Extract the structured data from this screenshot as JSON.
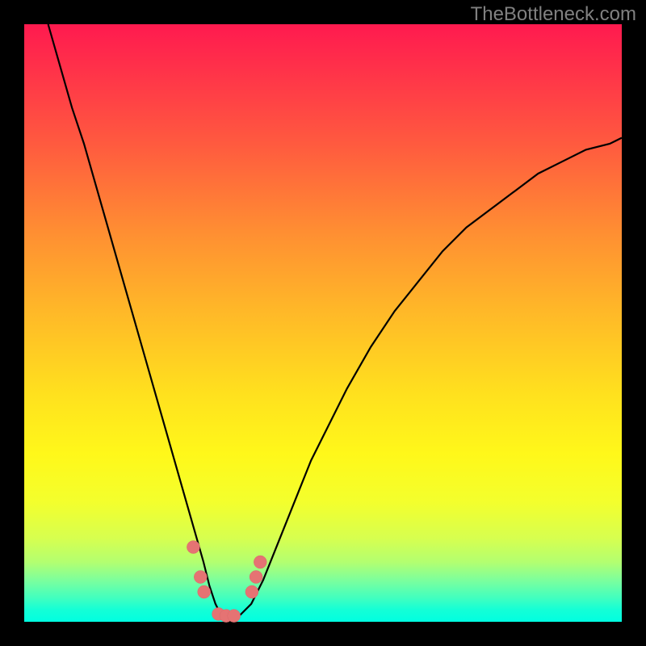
{
  "watermark": "TheBottleneck.com",
  "chart_data": {
    "type": "line",
    "title": "",
    "xlabel": "",
    "ylabel": "",
    "xlim": [
      0,
      100
    ],
    "ylim": [
      0,
      100
    ],
    "grid": false,
    "legend": false,
    "background_gradient": {
      "top": "#ff1a4f",
      "bottom": "#00ffe1"
    },
    "series": [
      {
        "name": "curve",
        "color": "#000000",
        "x": [
          4,
          6,
          8,
          10,
          12,
          14,
          16,
          18,
          20,
          22,
          24,
          26,
          28,
          30,
          31,
          32,
          33,
          34,
          35,
          36,
          38,
          40,
          42,
          44,
          46,
          48,
          50,
          54,
          58,
          62,
          66,
          70,
          74,
          78,
          82,
          86,
          90,
          94,
          98,
          100
        ],
        "y": [
          100,
          93,
          86,
          80,
          73,
          66,
          59,
          52,
          45,
          38,
          31,
          24,
          17,
          10,
          6,
          3,
          1,
          0,
          0,
          1,
          3,
          7,
          12,
          17,
          22,
          27,
          31,
          39,
          46,
          52,
          57,
          62,
          66,
          69,
          72,
          75,
          77,
          79,
          80,
          81
        ]
      }
    ],
    "markers": {
      "name": "highlight-points",
      "color": "#e57373",
      "radius_px": 8,
      "points": [
        {
          "x": 28.3,
          "y": 12.5
        },
        {
          "x": 29.5,
          "y": 7.5
        },
        {
          "x": 30.1,
          "y": 5.0
        },
        {
          "x": 32.5,
          "y": 1.3
        },
        {
          "x": 33.8,
          "y": 1.0
        },
        {
          "x": 35.1,
          "y": 1.0
        },
        {
          "x": 38.1,
          "y": 5.0
        },
        {
          "x": 38.8,
          "y": 7.5
        },
        {
          "x": 39.5,
          "y": 10.0
        }
      ]
    }
  }
}
